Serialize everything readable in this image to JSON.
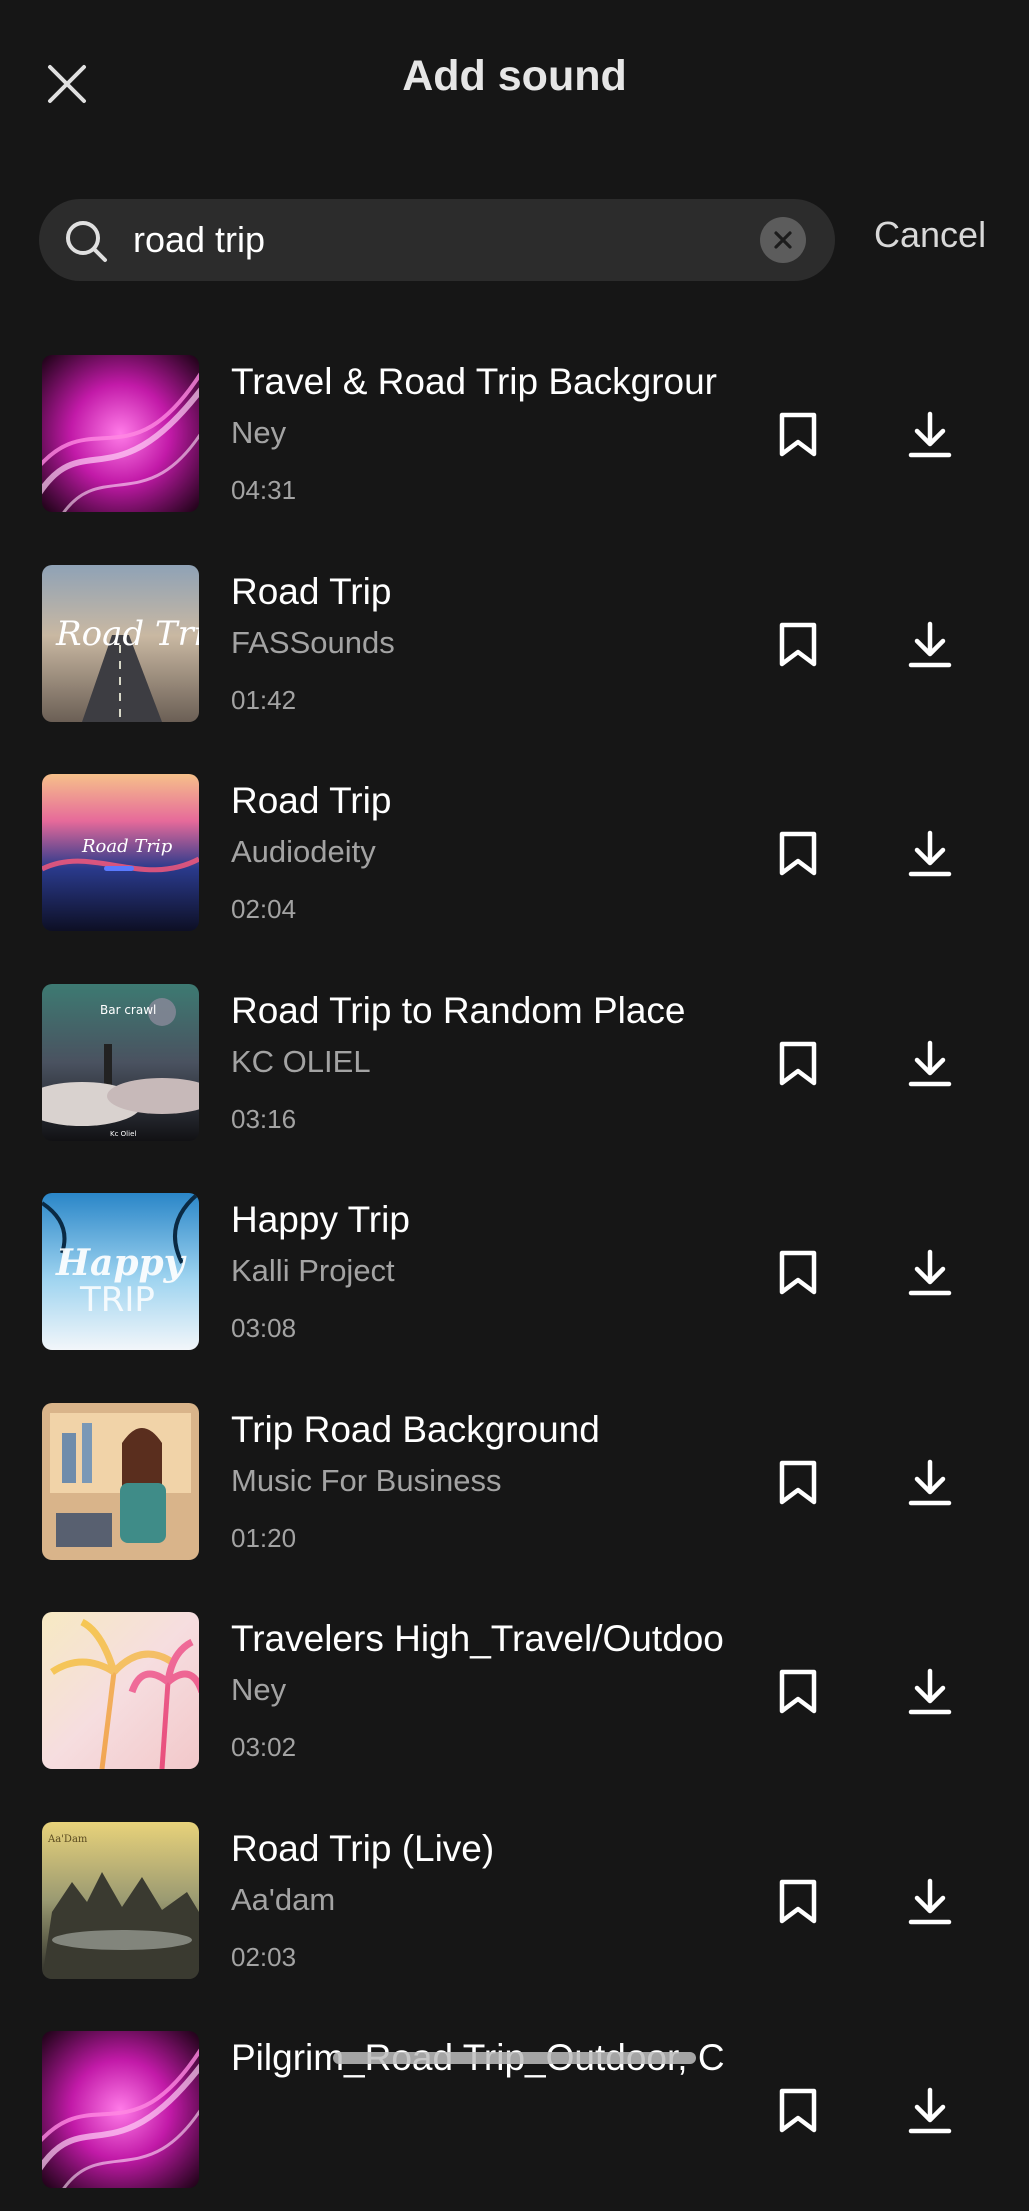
{
  "header": {
    "title": "Add sound",
    "close_icon": "close-icon"
  },
  "search": {
    "value": "road trip",
    "placeholder": "",
    "cancel_label": "Cancel",
    "icon": "search-icon",
    "clear_icon": "clear-icon"
  },
  "colors": {
    "background": "#161616",
    "search_bg": "#2c2c2c",
    "primary_text": "#ffffff",
    "secondary_text": "#a3a3a3"
  },
  "sounds": [
    {
      "title": "Travel & Road Trip Backgrour",
      "artist": "Ney",
      "duration": "04:31",
      "art": "magenta-waves"
    },
    {
      "title": "Road Trip",
      "artist": "FASSounds",
      "duration": "01:42",
      "art": "desert-highway"
    },
    {
      "title": "Road Trip",
      "artist": "Audiodeity",
      "duration": "02:04",
      "art": "sunset-gradient"
    },
    {
      "title": "Road Trip to Random Place",
      "artist": "KC OLIEL",
      "duration": "03:16",
      "art": "city-clouds"
    },
    {
      "title": "Happy Trip",
      "artist": "Kalli Project",
      "duration": "03:08",
      "art": "palm-sky"
    },
    {
      "title": "Trip Road Background",
      "artist": "Music For Business",
      "duration": "01:20",
      "art": "illustrated-woman"
    },
    {
      "title": "Travelers High_Travel/Outdoo",
      "artist": "Ney",
      "duration": "03:02",
      "art": "colorful-palms"
    },
    {
      "title": "Road Trip (Live)",
      "artist": "Aa'dam",
      "duration": "02:03",
      "art": "island-city"
    },
    {
      "title": "Pilgrim_Road Trip_Outdoor, C",
      "artist": "",
      "duration": "",
      "art": "magenta-waves"
    }
  ]
}
